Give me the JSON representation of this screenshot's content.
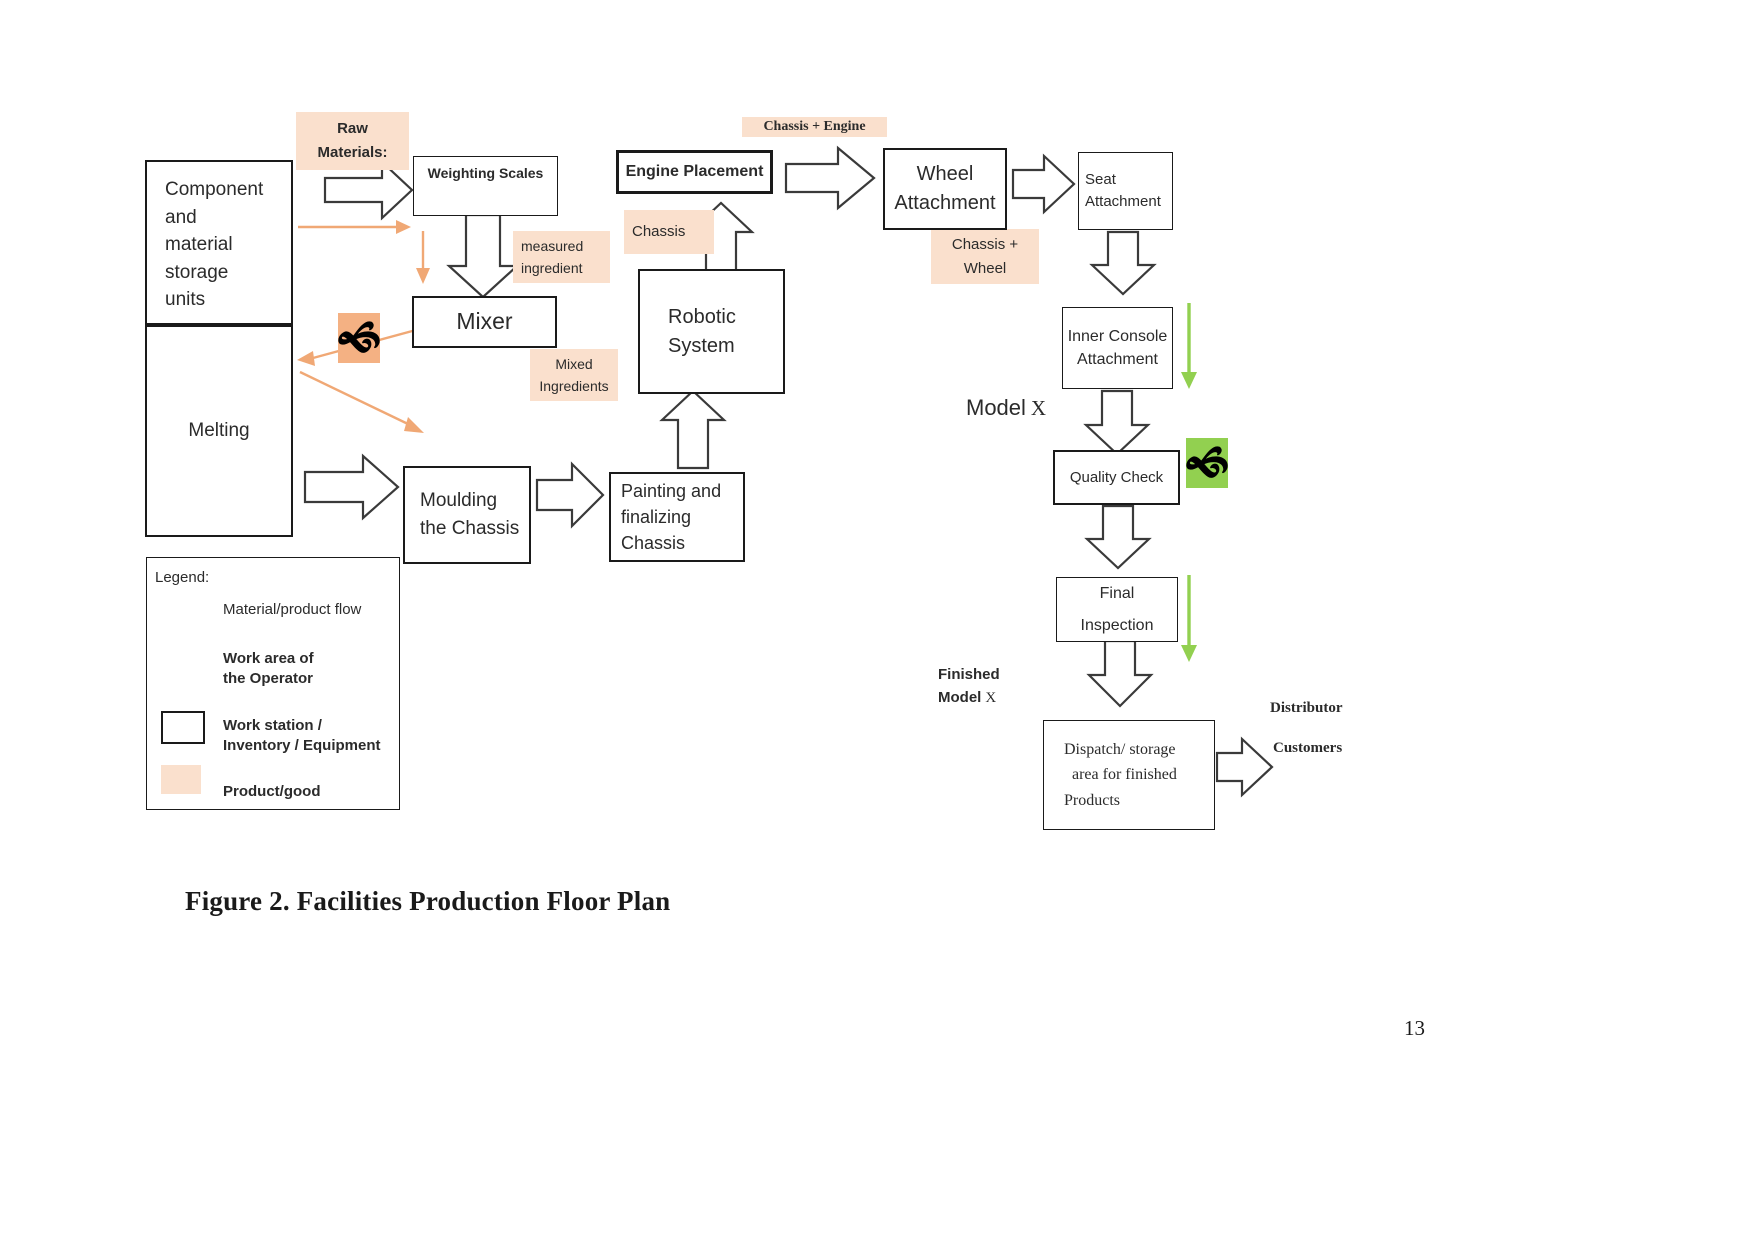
{
  "document": {
    "caption": "Figure 2. Facilities Production Floor Plan",
    "page_number": "13"
  },
  "stations": {
    "component_storage": "Component and material storage units",
    "component_storage_lines": [
      "Component",
      "and",
      "material",
      "storage",
      "units"
    ],
    "melting": "Melting",
    "weighting_scales": "Weighting Scales",
    "mixer": "Mixer",
    "moulding_line1": "Moulding",
    "moulding_line2": "the Chassis",
    "painting_line1": "Painting and",
    "painting_line2": "finalizing",
    "painting_line3": "Chassis",
    "robotic_line1": "Robotic",
    "robotic_line2": "System",
    "engine_placement": "Engine Placement",
    "wheel_line1": "Wheel",
    "wheel_line2": "Attachment",
    "seat_line1": "Seat",
    "seat_line2": "Attachment",
    "inner_console_line1": "Inner Console",
    "inner_console_line2": "Attachment",
    "quality_check": "Quality Check",
    "final_line1": "Final",
    "final_line2": "Inspection",
    "dispatch_line1": "Dispatch/ storage",
    "dispatch_line2": "area for finished",
    "dispatch_line3": "Products"
  },
  "product_tags": {
    "raw_materials_line1": "Raw",
    "raw_materials_line2": "Materials:",
    "measured_line1": "measured",
    "measured_line2": "ingredient",
    "mixed_line1": "Mixed",
    "mixed_line2": "Ingredients",
    "chassis": "Chassis",
    "chassis_engine": "Chassis + Engine",
    "chassis_wheel_line1": "Chassis +",
    "chassis_wheel_line2": "Wheel"
  },
  "annotations": {
    "model_x_prefix": "Model",
    "model_x_suffix": "X",
    "finished_line1": "Finished",
    "finished_model_prefix": "Model",
    "finished_model_suffix": "X",
    "distributor": "Distributor",
    "customers": "Customers"
  },
  "legend": {
    "title": "Legend:",
    "items": [
      {
        "symbol": "block-arrow-icon",
        "label_line1": "Material/product flow",
        "label_line2": ""
      },
      {
        "symbol": "thin-arrow-icon",
        "label_line1": "Work area of",
        "label_line2": "the Operator"
      },
      {
        "symbol": "empty-rect-icon",
        "label_line1": "Work station /",
        "label_line2": "Inventory / Equipment"
      },
      {
        "symbol": "peach-swatch-icon",
        "label_line1": "Product/good",
        "label_line2": ""
      }
    ]
  },
  "colors": {
    "product_tag_fill": "#fae0cd",
    "operator_peach": "#f4b183",
    "operator_green": "#92d050",
    "flow_arrow_stroke": "#3a3a3a",
    "operator_path_arrow": "#f0a875",
    "box_border": "#1a1a1a"
  },
  "icons": {
    "operator_marker": "operator-person-icon"
  }
}
